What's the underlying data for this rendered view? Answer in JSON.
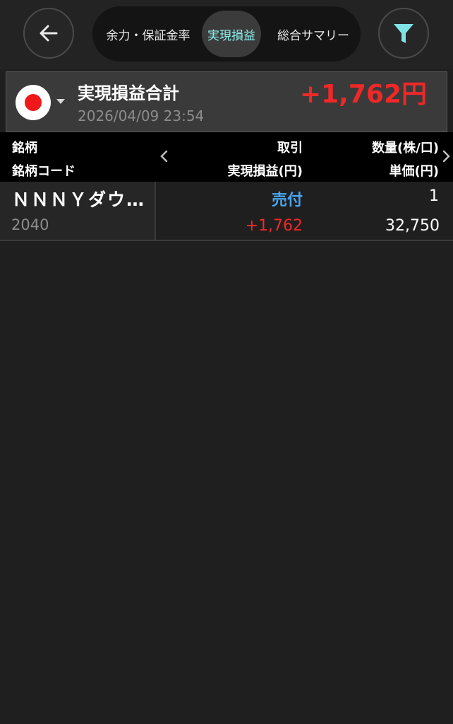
{
  "header": {
    "back_icon": "arrow-left-icon",
    "filter_icon": "filter-icon",
    "tabs": [
      {
        "label": "余力・保証金率"
      },
      {
        "label": "実現損益"
      },
      {
        "label": "総合サマリー"
      }
    ],
    "active_tab_color": "#8ff3f0"
  },
  "summary": {
    "market_flag_icon": "japan-flag-icon",
    "title": "実現損益合計",
    "datetime": "2026/04/09 23:54",
    "total": "+1,762円",
    "total_color": "#ef2828"
  },
  "columns": {
    "col1_line1": "銘柄",
    "col1_line2": "銘柄コード",
    "col2_line1": "取引",
    "col2_line2": "実現損益(円)",
    "col3_line1": "数量(株/口)",
    "col3_line2": "単価(円)"
  },
  "rows": [
    {
      "name": "ＮＮＮＹダウ…",
      "code": "2040",
      "side": "売付",
      "pnl": "+1,762",
      "quantity": "1",
      "unit_price": "32,750"
    }
  ],
  "colors": {
    "background": "#1f1f1f",
    "sell_blue": "#49a6ee",
    "profit_red": "#ef2828"
  }
}
